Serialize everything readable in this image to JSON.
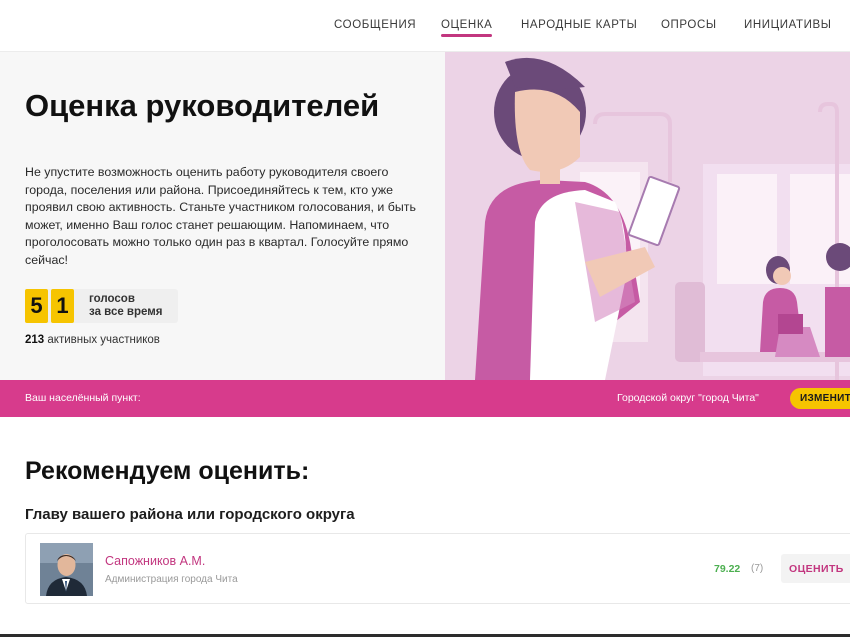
{
  "nav": {
    "items": [
      {
        "label": "СООБЩЕНИЯ"
      },
      {
        "label": "ОЦЕНКА",
        "active": true
      },
      {
        "label": "НАРОДНЫЕ КАРТЫ"
      },
      {
        "label": "ОПРОСЫ"
      },
      {
        "label": "ИНИЦИАТИВЫ"
      }
    ]
  },
  "hero": {
    "title": "Оценка руководителей",
    "description": "Не упустите возможность оценить работу руководителя своего города, поселения или района. Присоединяйтесь к тем, кто уже проявил свою активность. Станьте участником голосования, и быть может, именно Ваш голос станет решающим. Напоминаем, что проголосовать можно только один раз в квартал. Голосуйте прямо сейчас!",
    "votes_digits": [
      "5",
      "1"
    ],
    "votes_label_line1": "голосов",
    "votes_label_line2": "за все время",
    "participants_count": "213",
    "participants_label": "активных участников"
  },
  "location": {
    "label": "Ваш населённый пункт:",
    "value": "Городской округ \"город Чита\"",
    "change_button": "ИЗМЕНИТЬ"
  },
  "recommend": {
    "title": "Рекомендуем оценить:",
    "subtitle": "Главу вашего района или городского округа",
    "person": {
      "name": "Сапожников А.М.",
      "organization": "Администрация города Чита",
      "score": "79.22",
      "votes": "(7)",
      "rate_button": "ОЦЕНИТЬ"
    }
  },
  "colors": {
    "accent": "#c2367f",
    "bar": "#d73b8c",
    "yellow": "#f6c400",
    "score_green": "#4caf50"
  }
}
